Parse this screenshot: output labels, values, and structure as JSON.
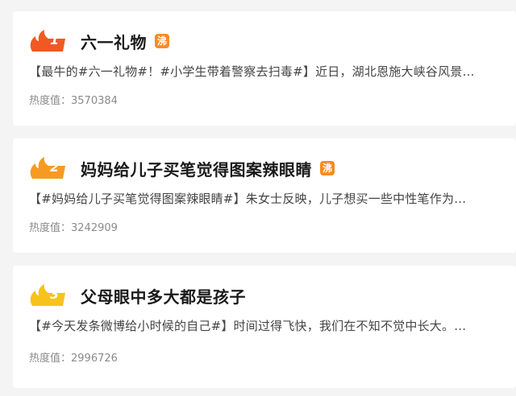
{
  "colors": {
    "rank1": "#f05a22",
    "rank2": "#f79a24",
    "rank3": "#f8c21c",
    "hot_tag": "#ff8a1f",
    "background": "#f4f4f5"
  },
  "items": [
    {
      "rank": "1",
      "title": "六一礼物",
      "tag": "沸",
      "summary": "【最牛的#六一礼物#！#小学生带着警察去扫毒#】近日，湖北恩施大峡谷风景…",
      "heat_label": "热度值：",
      "heat_value": "3570384",
      "icon": "flame-icon"
    },
    {
      "rank": "2",
      "title": "妈妈给儿子买笔觉得图案辣眼睛",
      "tag": "沸",
      "summary": "【#妈妈给儿子买笔觉得图案辣眼睛#】朱女士反映，儿子想买一些中性笔作为…",
      "heat_label": "热度值：",
      "heat_value": "3242909",
      "icon": "flame-icon"
    },
    {
      "rank": "3",
      "title": "父母眼中多大都是孩子",
      "summary": "【#今天发条微博给小时候的自己#】时间过得飞快，我们在不知不觉中长大。…",
      "heat_label": "热度值：",
      "heat_value": "2996726",
      "icon": "flame-icon"
    }
  ]
}
